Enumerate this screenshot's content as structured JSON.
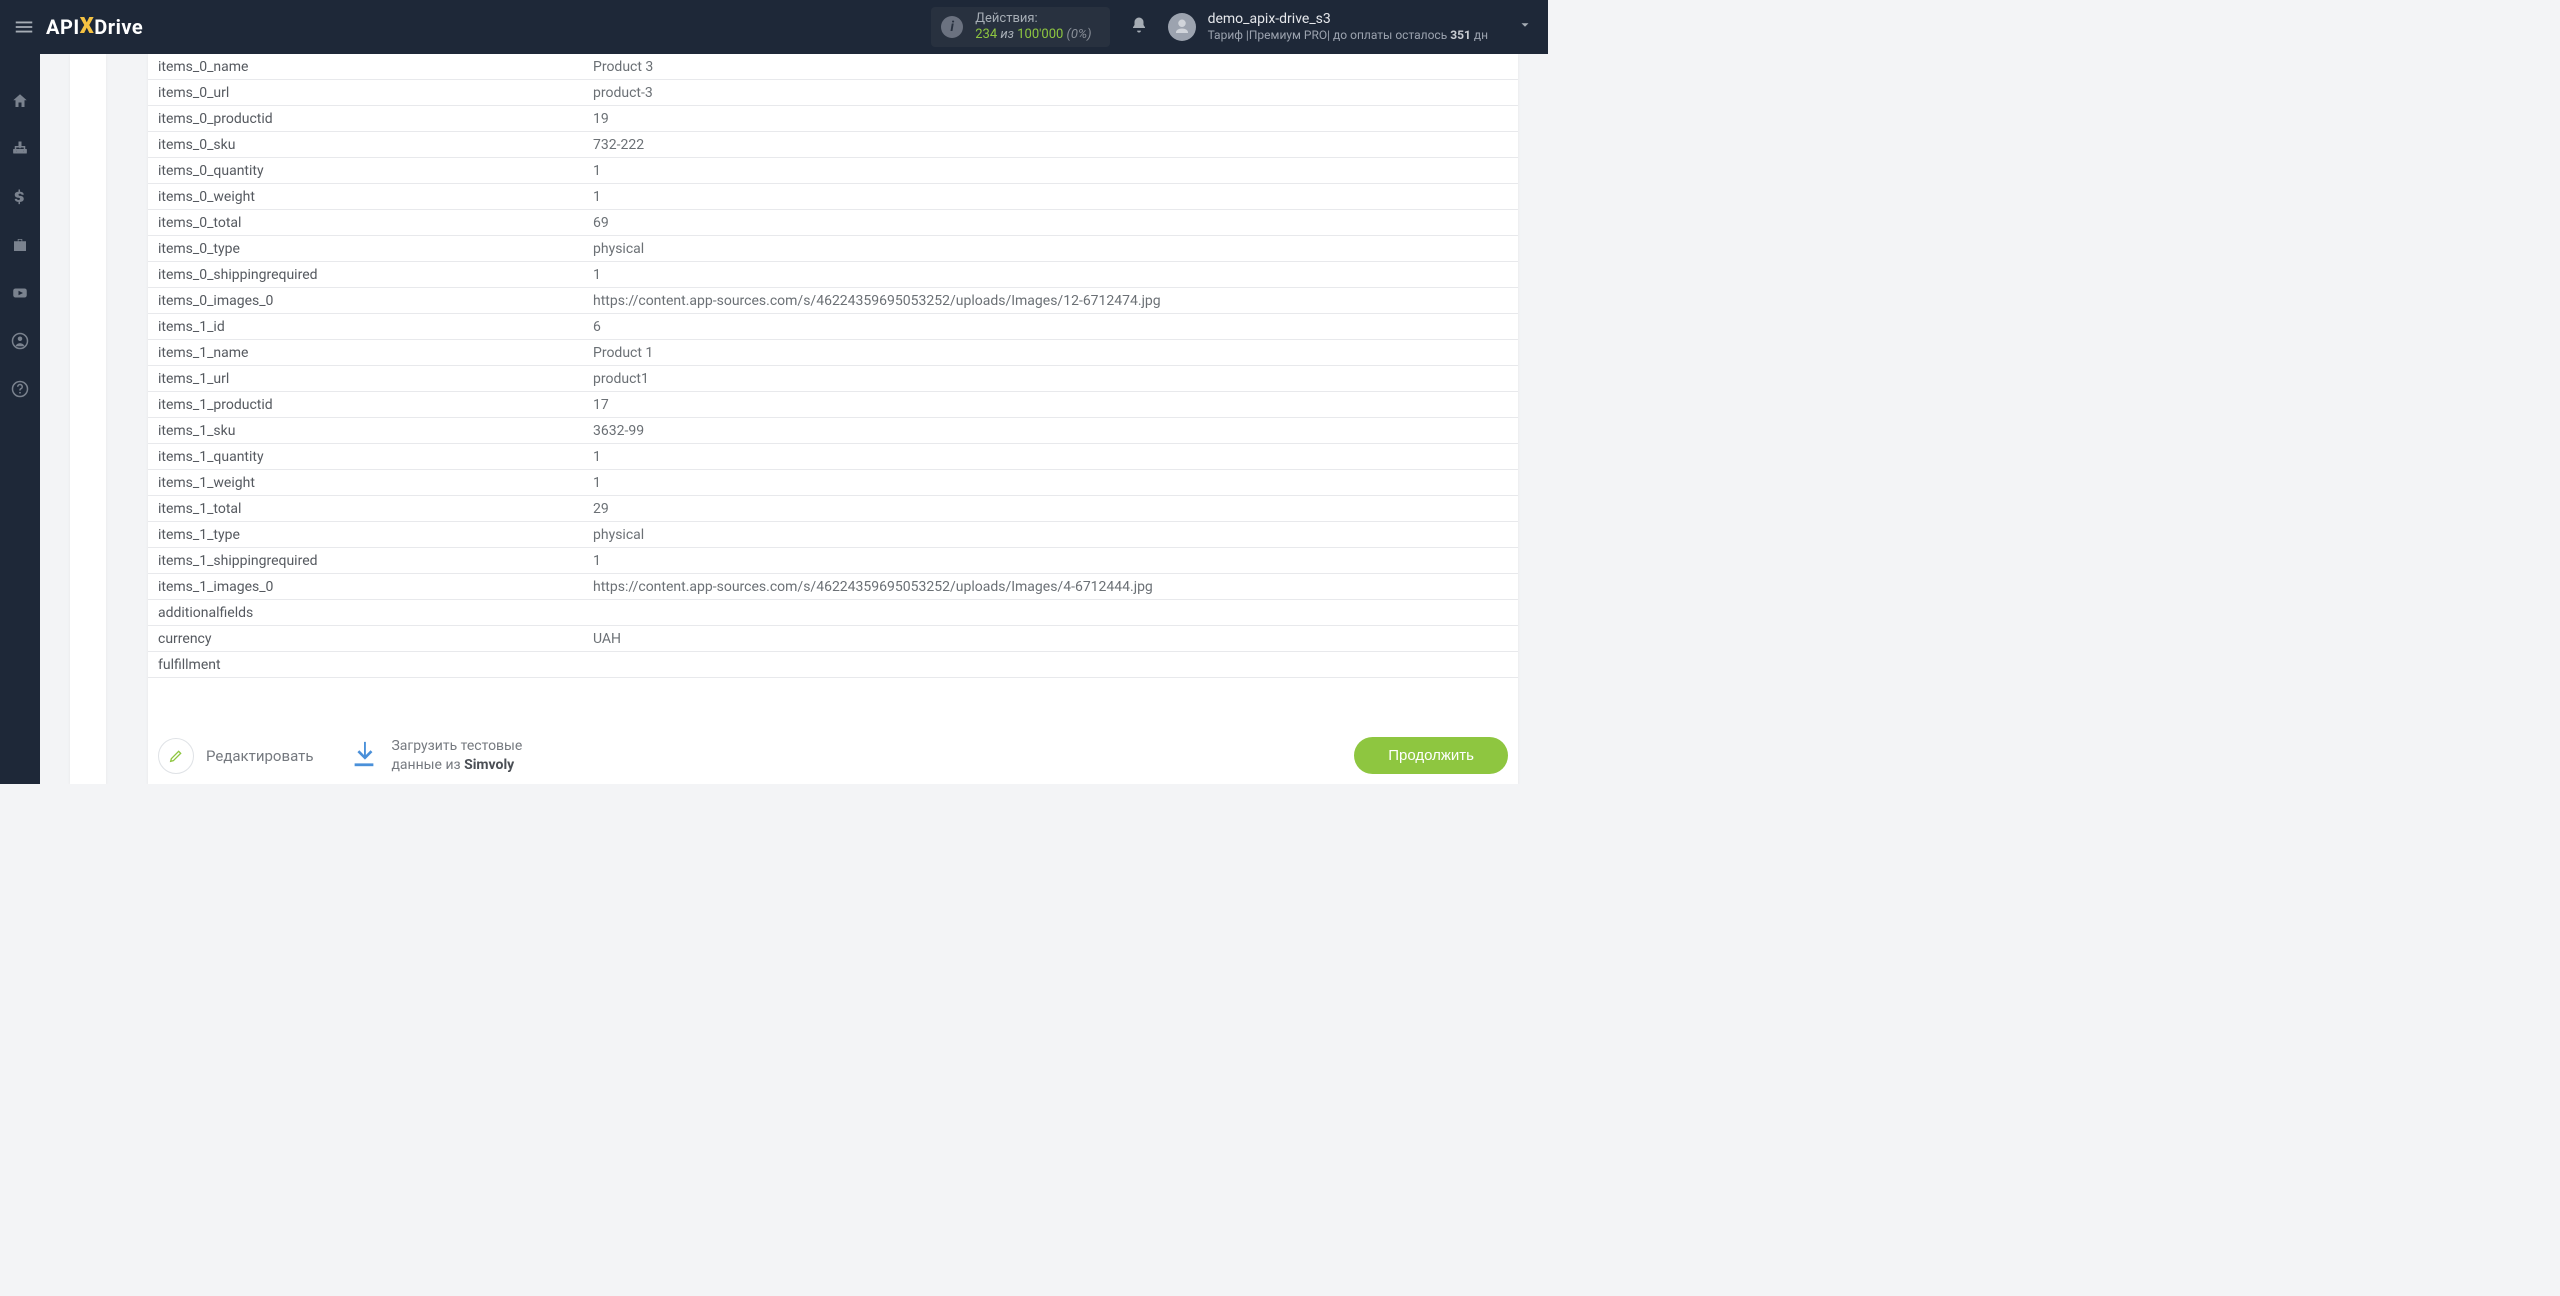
{
  "header": {
    "logo": {
      "api": "API",
      "x": "X",
      "drive": "Drive"
    },
    "actions": {
      "label": "Действия:",
      "count": "234",
      "of_word": " из ",
      "total": "100'000",
      "pct": " (0%)"
    },
    "user": {
      "name": "demo_apix-drive_s3",
      "plan_prefix": "Тариф |",
      "plan_name": "Премиум PRO",
      "plan_mid": "| до оплаты осталось ",
      "days": "351",
      "days_suffix": " дн"
    }
  },
  "rows": [
    {
      "k": "items_0_name",
      "v": "Product 3"
    },
    {
      "k": "items_0_url",
      "v": "product-3"
    },
    {
      "k": "items_0_productid",
      "v": "19"
    },
    {
      "k": "items_0_sku",
      "v": "732-222"
    },
    {
      "k": "items_0_quantity",
      "v": "1"
    },
    {
      "k": "items_0_weight",
      "v": "1"
    },
    {
      "k": "items_0_total",
      "v": "69"
    },
    {
      "k": "items_0_type",
      "v": "physical"
    },
    {
      "k": "items_0_shippingrequired",
      "v": "1"
    },
    {
      "k": "items_0_images_0",
      "v": "https://content.app-sources.com/s/46224359695053252/uploads/Images/12-6712474.jpg"
    },
    {
      "k": "items_1_id",
      "v": "6"
    },
    {
      "k": "items_1_name",
      "v": "Product 1"
    },
    {
      "k": "items_1_url",
      "v": "product1"
    },
    {
      "k": "items_1_productid",
      "v": "17"
    },
    {
      "k": "items_1_sku",
      "v": "3632-99"
    },
    {
      "k": "items_1_quantity",
      "v": "1"
    },
    {
      "k": "items_1_weight",
      "v": "1"
    },
    {
      "k": "items_1_total",
      "v": "29"
    },
    {
      "k": "items_1_type",
      "v": "physical"
    },
    {
      "k": "items_1_shippingrequired",
      "v": "1"
    },
    {
      "k": "items_1_images_0",
      "v": "https://content.app-sources.com/s/46224359695053252/uploads/Images/4-6712444.jpg"
    },
    {
      "k": "additionalfields",
      "v": ""
    },
    {
      "k": "currency",
      "v": "UAH"
    },
    {
      "k": "fulfillment",
      "v": ""
    }
  ],
  "footer": {
    "edit": "Редактировать",
    "load_line1": "Загрузить тестовые",
    "load_line2_prefix": "данные из ",
    "load_line2_bold": "Simvoly",
    "continue": "Продолжить"
  }
}
